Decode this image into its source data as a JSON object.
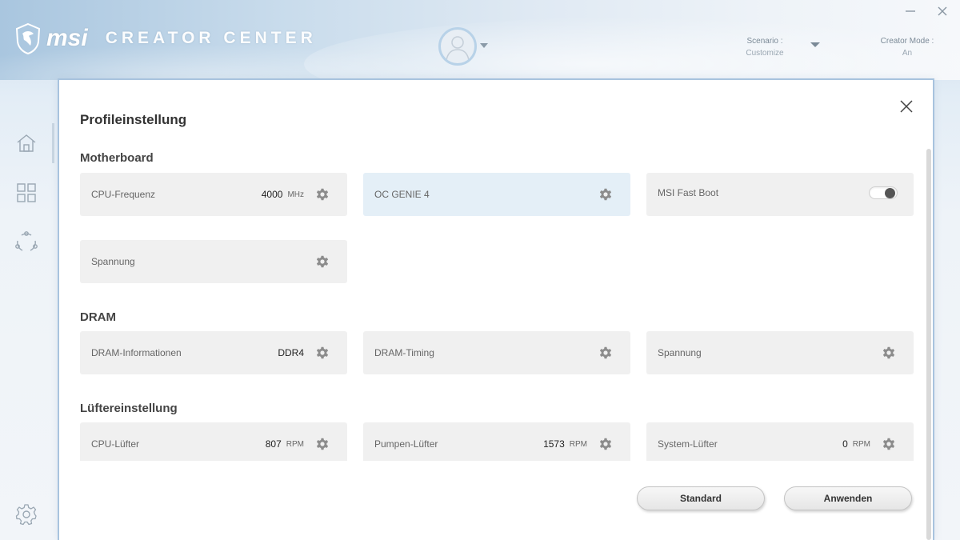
{
  "header": {
    "brand": "msi",
    "product": "CREATOR CENTER",
    "scenario_label": "Scenario :",
    "scenario_value": "Customize",
    "creator_mode_label": "Creator Mode :",
    "creator_mode_value": "An"
  },
  "dialog": {
    "title": "Profileinstellung",
    "sections": {
      "motherboard": {
        "title": "Motherboard",
        "cpu_freq": {
          "label": "CPU-Frequenz",
          "value": "4000",
          "unit": "MHz"
        },
        "oc_genie": {
          "label": "OC GENIE 4"
        },
        "fast_boot": {
          "label": "MSI Fast Boot",
          "enabled": true
        },
        "voltage": {
          "label": "Spannung"
        }
      },
      "dram": {
        "title": "DRAM",
        "info": {
          "label": "DRAM-Informationen",
          "value": "DDR4"
        },
        "timing": {
          "label": "DRAM-Timing"
        },
        "voltage": {
          "label": "Spannung"
        }
      },
      "fan": {
        "title": "Lüftereinstellung",
        "cpu_fan": {
          "label": "CPU-Lüfter",
          "value": "807",
          "unit": "RPM"
        },
        "pump_fan": {
          "label": "Pumpen-Lüfter",
          "value": "1573",
          "unit": "RPM"
        },
        "system_fan": {
          "label": "System-Lüfter",
          "value": "0",
          "unit": "RPM"
        }
      }
    },
    "buttons": {
      "standard": "Standard",
      "apply": "Anwenden"
    }
  },
  "colors": {
    "accent_border": "#a8c3de",
    "card_bg": "#f0f0f0",
    "card_highlight": "#e4eff7"
  }
}
